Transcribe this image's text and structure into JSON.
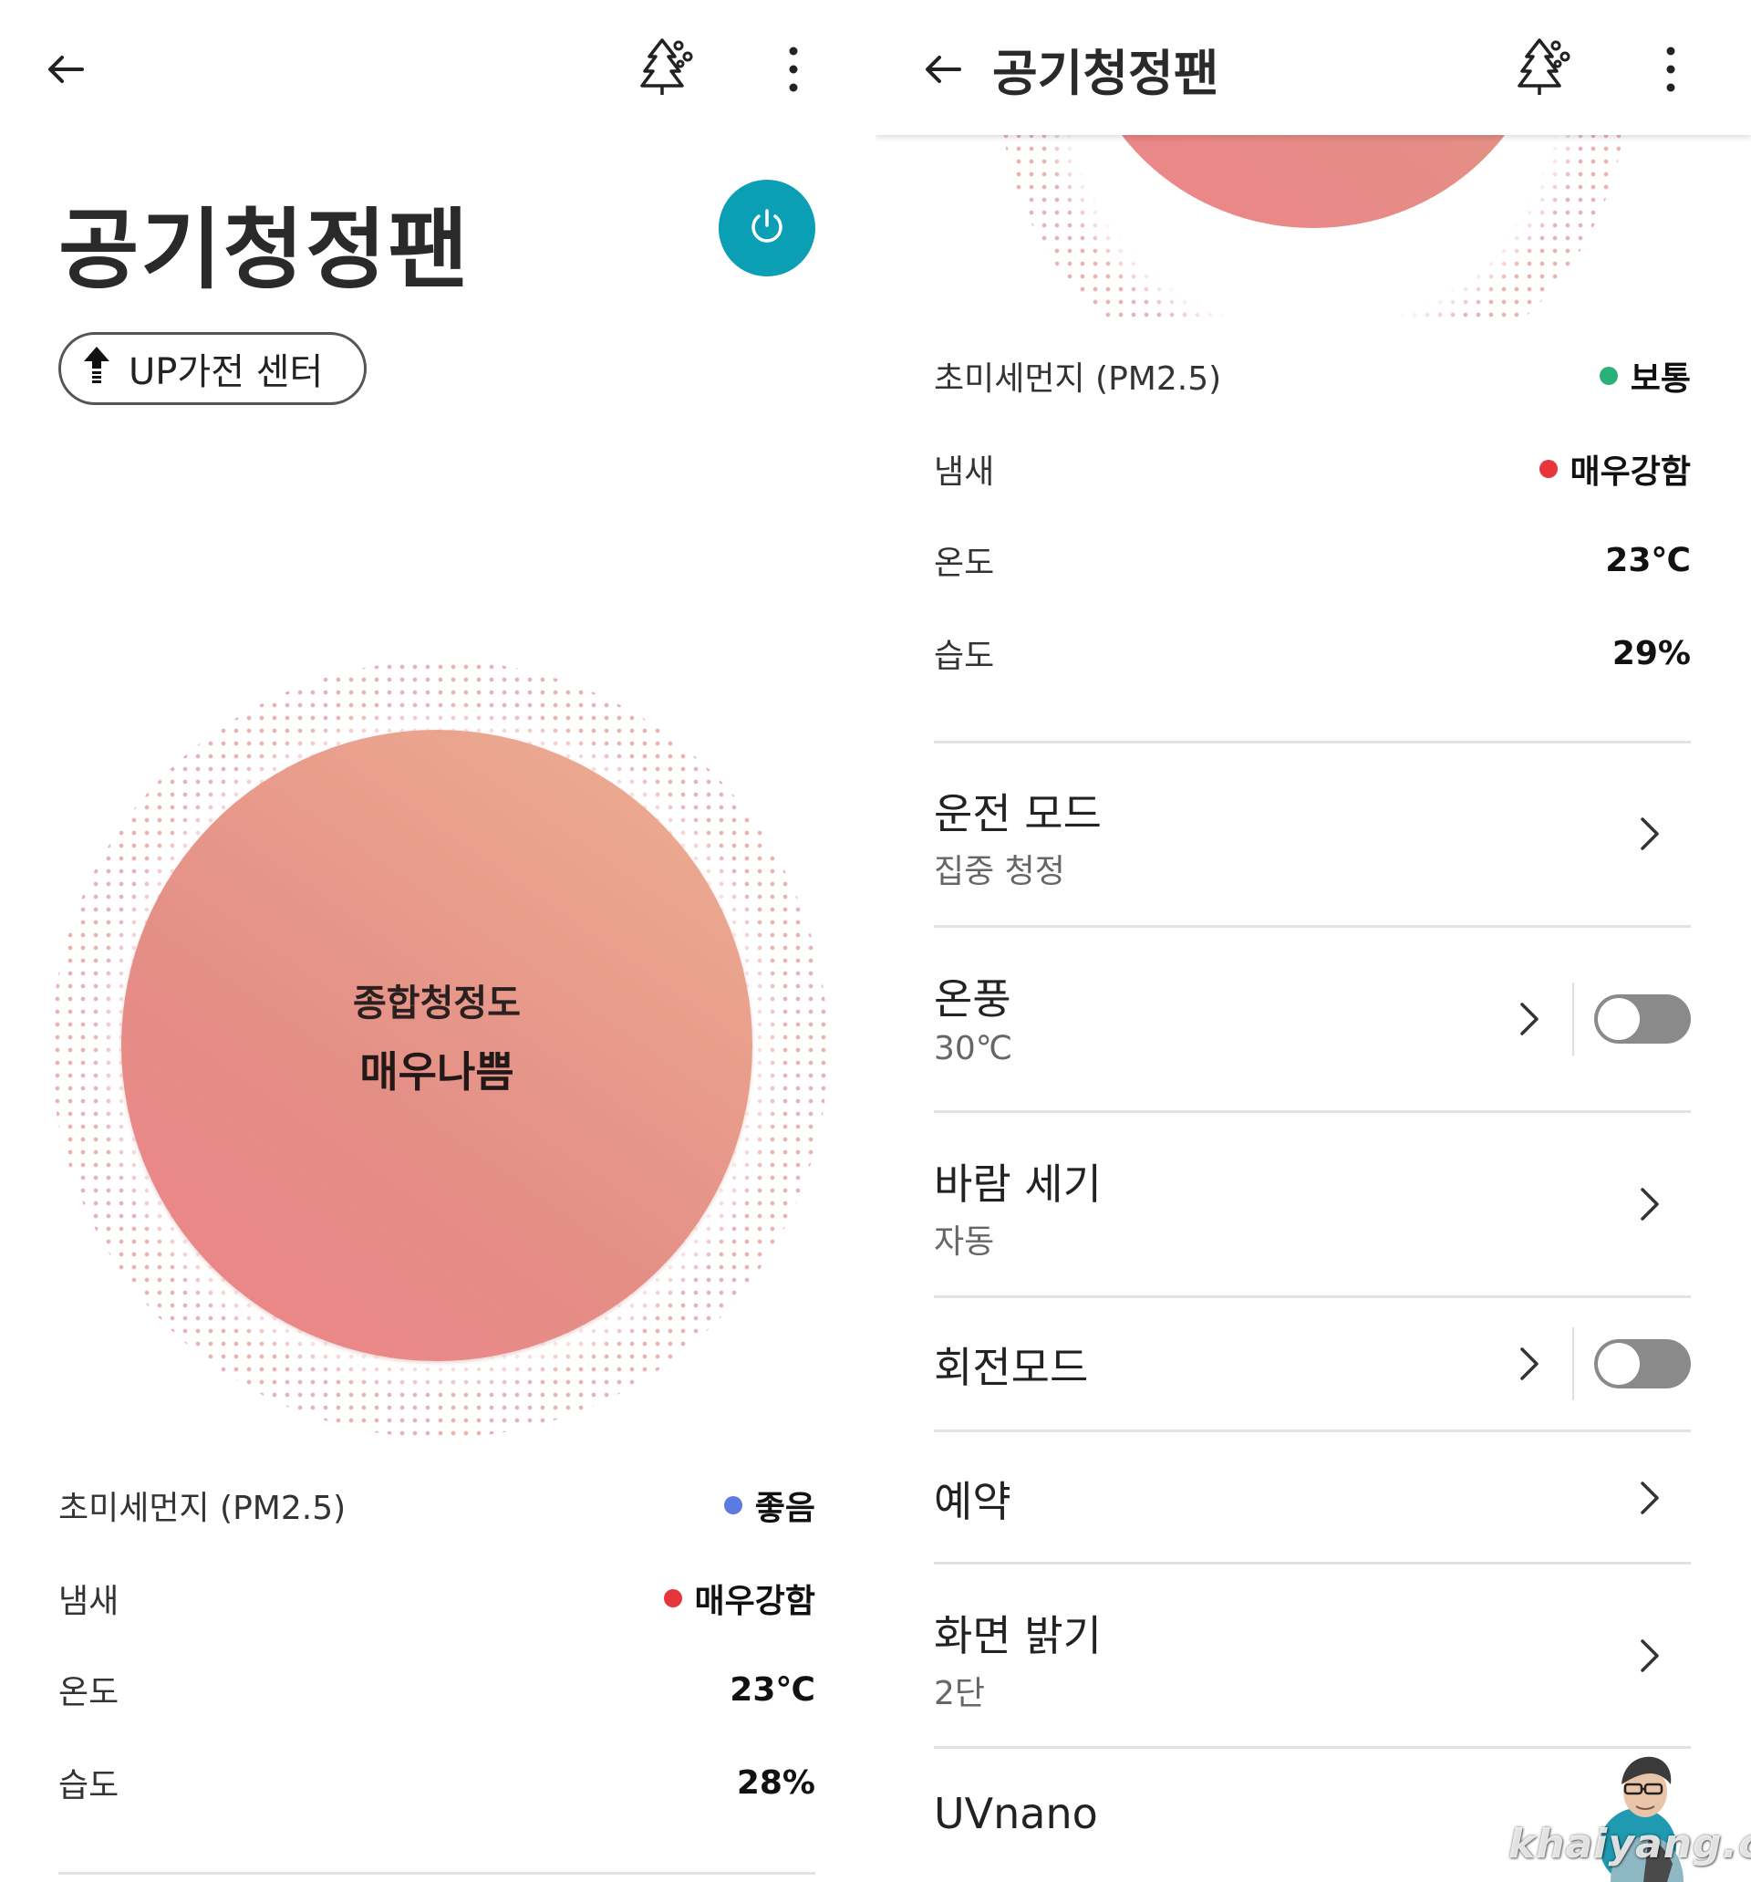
{
  "left": {
    "title": "공기청정팬",
    "up_center": "UP가전 센터",
    "circle": {
      "label": "종합청정도",
      "value": "매우나쁨"
    },
    "stats": [
      {
        "label": "초미세먼지 (PM2.5)",
        "value": "좋음",
        "dot": "#5b7be0"
      },
      {
        "label": "냄새",
        "value": "매우강함",
        "dot": "#e6363c"
      },
      {
        "label": "온도",
        "value": "23℃"
      },
      {
        "label": "습도",
        "value": "28%"
      }
    ]
  },
  "right": {
    "title": "공기청정팬",
    "stats": [
      {
        "label": "초미세먼지 (PM2.5)",
        "value": "보통",
        "dot": "#2bb07a"
      },
      {
        "label": "냄새",
        "value": "매우강함",
        "dot": "#e6363c"
      },
      {
        "label": "온도",
        "value": "23℃"
      },
      {
        "label": "습도",
        "value": "29%"
      }
    ],
    "menu": [
      {
        "title": "운전 모드",
        "sub": "집중 청정"
      },
      {
        "title": "온풍",
        "sub": "30℃",
        "toggle": false
      },
      {
        "title": "바람 세기",
        "sub": "자동"
      },
      {
        "title": "회전모드",
        "toggle": false
      },
      {
        "title": "예약"
      },
      {
        "title": "화면 밝기",
        "sub": "2단"
      },
      {
        "title": "UVnano"
      }
    ]
  },
  "watermark": "khaiyang.com",
  "colors": {
    "accent": "#0a9fb5",
    "toggle_off": "#8a8a8a"
  },
  "icons": [
    "back-arrow-icon",
    "tree-icon",
    "more-vert-icon",
    "power-icon",
    "upload-arrow-icon",
    "chevron-right-icon"
  ]
}
